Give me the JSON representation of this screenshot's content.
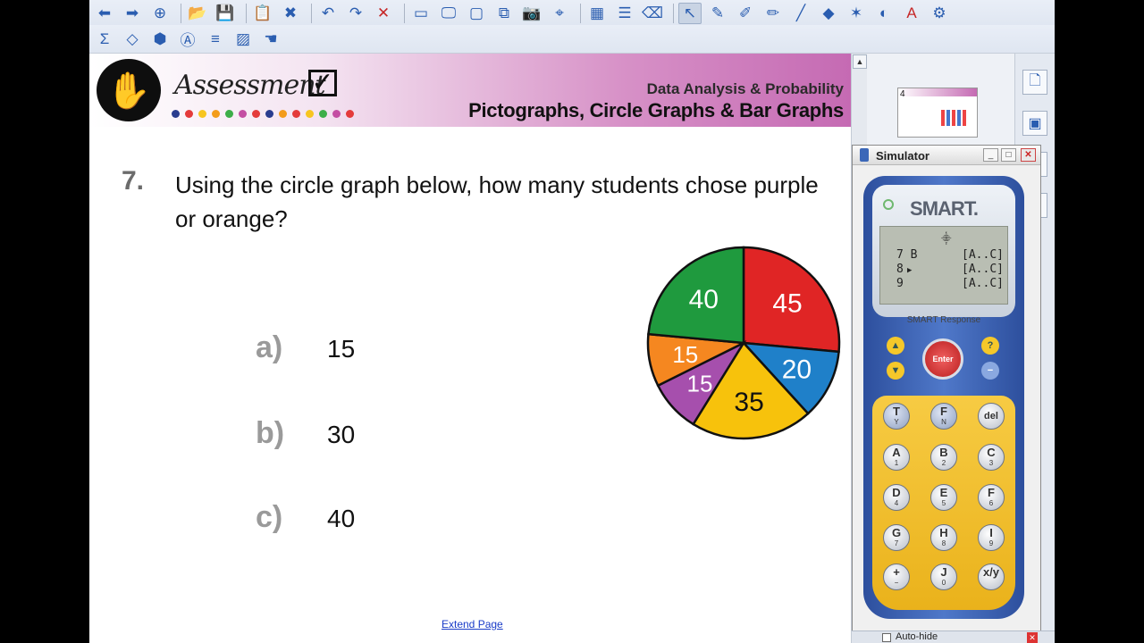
{
  "toolbar_row1": [
    "back-icon",
    "forward-icon",
    "add-page-icon",
    "open-icon",
    "save-icon",
    "paste-icon",
    "delete-page-icon",
    "undo-icon",
    "redo-icon",
    "delete-icon",
    "screen-shade-icon",
    "full-screen-icon",
    "transparent-bg-icon",
    "dual-view-icon",
    "capture-icon",
    "document-camera-icon",
    "table-icon",
    "properties-icon",
    "clear-icon",
    "select-icon",
    "pen-icon",
    "creative-pen-icon",
    "highlighter-icon",
    "line-icon",
    "shape-icon",
    "magic-pen-icon",
    "fill-icon",
    "text-icon",
    "tools-icon"
  ],
  "toolbar_row2": [
    "sum-icon",
    "response-icon",
    "star-icon",
    "font-icon",
    "layout-icon",
    "graph-icon",
    "hand-icon"
  ],
  "banner": {
    "assessment_word": "Assessment",
    "check_mark": "☑",
    "subtitle": "Data Analysis & Probability",
    "title": "Pictographs, Circle Graphs & Bar Graphs",
    "dot_colors": [
      "#2a3d8f",
      "#e43b3b",
      "#f7c520",
      "#f39c1b",
      "#3dae49",
      "#c44ea3",
      "#e43b3b",
      "#2a3d8f",
      "#f39c1b",
      "#e43b3b",
      "#f7c520",
      "#3dae49",
      "#c44ea3",
      "#e43b3b"
    ]
  },
  "question": {
    "number": "7.",
    "text": "Using the circle graph below, how many students chose purple or orange?"
  },
  "answers": [
    {
      "letter": "a)",
      "value": "15"
    },
    {
      "letter": "b)",
      "value": "30"
    },
    {
      "letter": "c)",
      "value": "40"
    }
  ],
  "chart_data": {
    "type": "pie",
    "slices": [
      {
        "label": "45",
        "value": 45,
        "color": "#e02525"
      },
      {
        "label": "20",
        "value": 20,
        "color": "#1f80c9"
      },
      {
        "label": "35",
        "value": 35,
        "color": "#f7c20c"
      },
      {
        "label": "15",
        "value": 15,
        "color": "#a64fad"
      },
      {
        "label": "15",
        "value": 15,
        "color": "#f58720"
      },
      {
        "label": "40",
        "value": 40,
        "color": "#1f9a3e"
      }
    ]
  },
  "extend_link": "Extend Page",
  "thumbnail": {
    "page_number": "4"
  },
  "side_icons": [
    "page-sorter-icon",
    "gallery-icon",
    "attachments-icon",
    "properties-icon"
  ],
  "simulator": {
    "title": "Simulator",
    "brand_logo": "SMART.",
    "brand_text": "SMART Response",
    "lcd_icon": "⸎",
    "lcd_rows": [
      {
        "left": "7 B",
        "right": "[A..C]"
      },
      {
        "left": "8",
        "right": "[A..C]"
      },
      {
        "left": "9",
        "right": "[A..C]"
      }
    ],
    "lcd_arrow": "▶",
    "enter_label": "Enter",
    "nav_up": "▲",
    "nav_down": "▼",
    "help": "?",
    "minus": "−",
    "keys": [
      {
        "main": "T",
        "sub": "Y"
      },
      {
        "main": "F",
        "sub": "N"
      },
      {
        "main": "del",
        "sub": ""
      },
      {
        "main": "A",
        "sub": "1"
      },
      {
        "main": "B",
        "sub": "2"
      },
      {
        "main": "C",
        "sub": "3"
      },
      {
        "main": "D",
        "sub": "4"
      },
      {
        "main": "E",
        "sub": "5"
      },
      {
        "main": "F",
        "sub": "6"
      },
      {
        "main": "G",
        "sub": "7"
      },
      {
        "main": "H",
        "sub": "8"
      },
      {
        "main": "I",
        "sub": "9"
      },
      {
        "main": "+",
        "sub": "−"
      },
      {
        "main": "J",
        "sub": "0"
      },
      {
        "main": "x/y",
        "sub": ""
      }
    ]
  },
  "bottom_bar": {
    "autohide": "Auto-hide"
  }
}
